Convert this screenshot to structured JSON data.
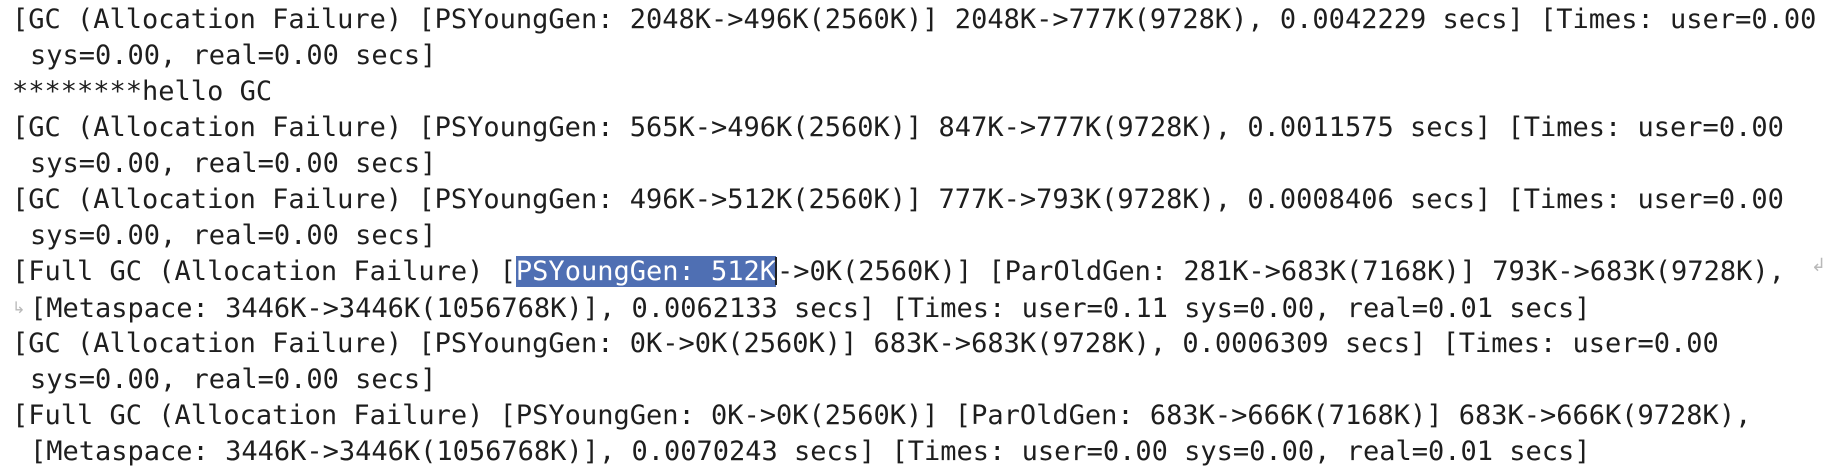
{
  "console": {
    "lines": [
      "[GC (Allocation Failure) [PSYoungGen: 2048K->496K(2560K)] 2048K->777K(9728K), 0.0042229 secs] [Times: user=0.00",
      "sys=0.00, real=0.00 secs]",
      "********hello GC",
      "[GC (Allocation Failure) [PSYoungGen: 565K->496K(2560K)] 847K->777K(9728K), 0.0011575 secs] [Times: user=0.00",
      "sys=0.00, real=0.00 secs]",
      "[GC (Allocation Failure) [PSYoungGen: 496K->512K(2560K)] 777K->793K(9728K), 0.0008406 secs] [Times: user=0.00",
      "sys=0.00, real=0.00 secs]",
      "[Metaspace: 3446K->3446K(1056768K)], 0.0062133 secs] [Times: user=0.11 sys=0.00, real=0.01 secs]",
      "[GC (Allocation Failure) [PSYoungGen: 0K->0K(2560K)] 683K->683K(9728K), 0.0006309 secs] [Times: user=0.00",
      "sys=0.00, real=0.00 secs]",
      "[Full GC (Allocation Failure) [PSYoungGen: 0K->0K(2560K)] [ParOldGen: 683K->666K(7168K)] 683K->666K(9728K),",
      "[Metaspace: 3446K->3446K(1056768K)], 0.0070243 secs] [Times: user=0.00 sys=0.00, real=0.01 secs]"
    ],
    "full_gc_line": {
      "before": "[Full GC (Allocation Failure) [",
      "selected": "PSYoungGen: 512K",
      "after": "->0K(2560K)] [ParOldGen: 281K->683K(7168K)] 793K->683K(9728K),"
    },
    "wrap_icon": "wrap-arrow-icon",
    "selection_color": "#4f6fb3"
  }
}
